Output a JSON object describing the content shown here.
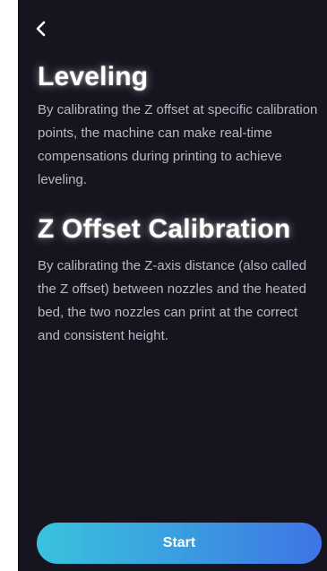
{
  "header": {
    "back_icon": "chevron-left-icon"
  },
  "sections": [
    {
      "title": "Leveling",
      "body": "By calibrating the Z offset at specific calibration points, the machine can make real-time compensations during printing to achieve leveling."
    },
    {
      "title": "Z Offset Calibration",
      "body": "By calibrating the Z-axis distance (also called the Z offset) between nozzles and the heated bed, the two nozzles can print at the correct and consistent height."
    }
  ],
  "footer": {
    "start_label": "Start"
  },
  "colors": {
    "background": "#15141f",
    "text_primary": "#ffffff",
    "text_secondary": "#b9b8c4",
    "button_gradient_start": "#3ac3dd",
    "button_gradient_end": "#3f74e5"
  }
}
